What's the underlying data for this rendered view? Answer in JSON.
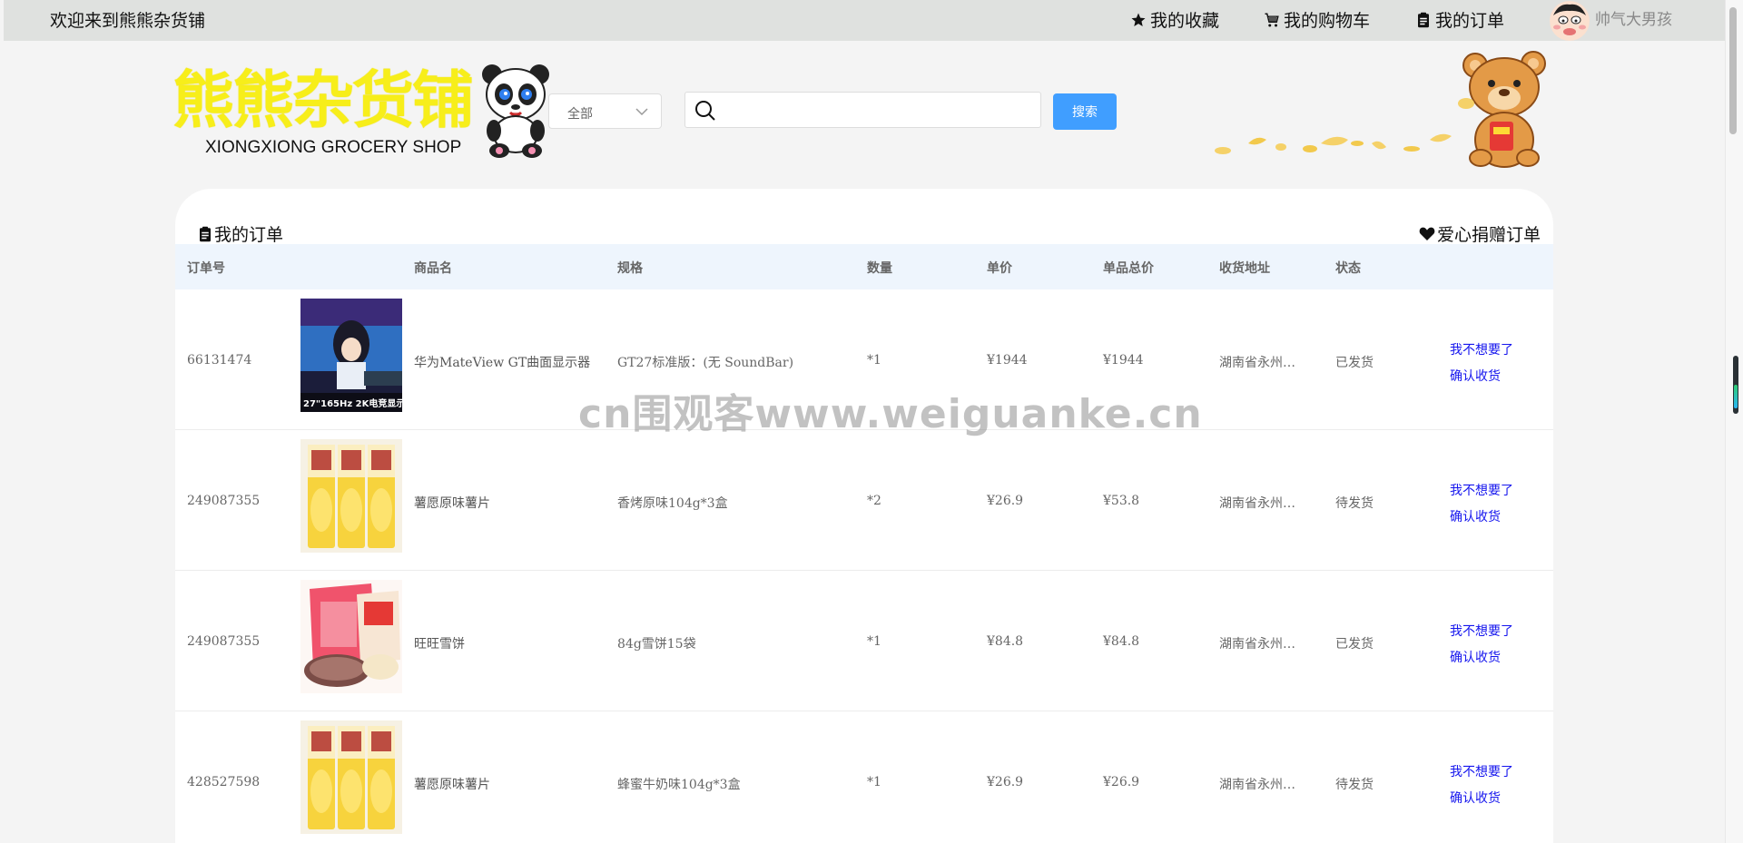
{
  "topbar": {
    "welcome": "欢迎来到熊熊杂货铺",
    "favorites": "我的收藏",
    "cart": "我的购物车",
    "orders": "我的订单",
    "username": "帅气大男孩"
  },
  "header": {
    "logo_title": "熊熊杂货铺",
    "logo_subtitle": "XIONGXIONG GROCERY SHOP",
    "category_selected": "全部",
    "search_placeholder": "",
    "search_button": "搜索"
  },
  "orders_panel": {
    "title": "我的订单",
    "donate_link": "爱心捐赠订单",
    "columns": [
      "订单号",
      "商品名",
      "规格",
      "数量",
      "单价",
      "单品总价",
      "收货地址",
      "状态"
    ],
    "rows": [
      {
        "id": "66131474",
        "name": "华为MateView GT曲面显示器",
        "spec": "GT27标准版：(无 SoundBar)",
        "qty": "*1",
        "price": "¥1944",
        "total": "¥1944",
        "address": "湖南省永州…",
        "status": "已发货",
        "thumb_text": "27\"165Hz 2K电竞显示",
        "action_cancel": "我不想要了",
        "action_confirm": "确认收货"
      },
      {
        "id": "249087355",
        "name": "薯愿原味薯片",
        "spec": "香烤原味104g*3盒",
        "qty": "*2",
        "price": "¥26.9",
        "total": "¥53.8",
        "address": "湖南省永州…",
        "status": "待发货",
        "action_cancel": "我不想要了",
        "action_confirm": "确认收货"
      },
      {
        "id": "249087355",
        "name": "旺旺雪饼",
        "spec": "84g雪饼15袋",
        "qty": "*1",
        "price": "¥84.8",
        "total": "¥84.8",
        "address": "湖南省永州…",
        "status": "已发货",
        "action_cancel": "我不想要了",
        "action_confirm": "确认收货"
      },
      {
        "id": "428527598",
        "name": "薯愿原味薯片",
        "spec": "蜂蜜牛奶味104g*3盒",
        "qty": "*1",
        "price": "¥26.9",
        "total": "¥26.9",
        "address": "湖南省永州…",
        "status": "待发货",
        "action_cancel": "我不想要了",
        "action_confirm": "确认收货"
      }
    ]
  },
  "watermark": "cn围观客www.weiguanke.cn",
  "colors": {
    "topbar_bg": "#dfe1df",
    "accent_blue": "#409eff",
    "logo_yellow": "#f7ee1a",
    "action_link": "#1515ee",
    "table_header_bg": "#eef5fd"
  },
  "icons": [
    "star-icon",
    "cart-icon",
    "clipboard-icon",
    "search-icon",
    "chevron-down-icon",
    "heart-icon"
  ]
}
